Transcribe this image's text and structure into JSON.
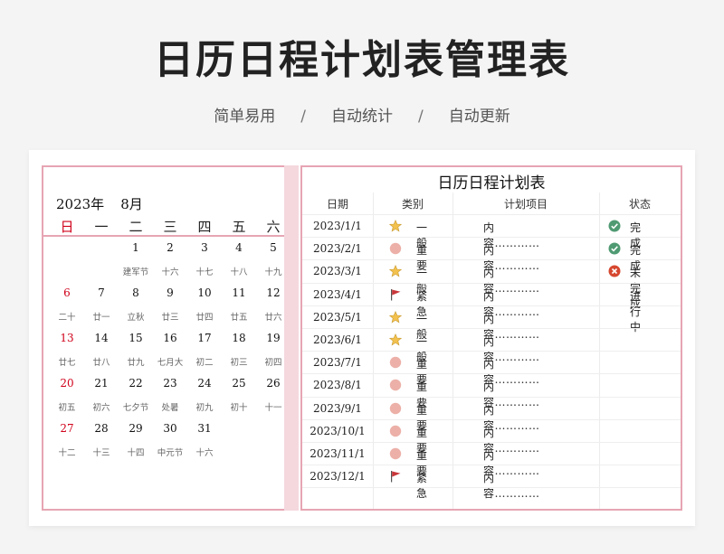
{
  "header": {
    "title": "日历日程计划表管理表",
    "subtitle": [
      "简单易用",
      "自动统计",
      "自动更新"
    ],
    "separator": "/"
  },
  "calendar": {
    "year_label": "2023年",
    "month_label": "8月",
    "weekdays": [
      "日",
      "一",
      "二",
      "三",
      "四",
      "五",
      "六"
    ],
    "weeks": [
      [
        [
          "",
          ""
        ],
        [
          "",
          ""
        ],
        [
          "1",
          "建军节"
        ],
        [
          "2",
          "十六"
        ],
        [
          "3",
          "十七"
        ],
        [
          "4",
          "十八"
        ],
        [
          "5",
          "十九"
        ]
      ],
      [
        [
          "6",
          "二十"
        ],
        [
          "7",
          "廿一"
        ],
        [
          "8",
          "立秋"
        ],
        [
          "9",
          "廿三"
        ],
        [
          "10",
          "廿四"
        ],
        [
          "11",
          "廿五"
        ],
        [
          "12",
          "廿六"
        ]
      ],
      [
        [
          "13",
          "廿七"
        ],
        [
          "14",
          "廿八"
        ],
        [
          "15",
          "廿九"
        ],
        [
          "16",
          "七月大"
        ],
        [
          "17",
          "初二"
        ],
        [
          "18",
          "初三"
        ],
        [
          "19",
          "初四"
        ]
      ],
      [
        [
          "20",
          "初五"
        ],
        [
          "21",
          "初六"
        ],
        [
          "22",
          "七夕节"
        ],
        [
          "23",
          "处暑"
        ],
        [
          "24",
          "初九"
        ],
        [
          "25",
          "初十"
        ],
        [
          "26",
          "十一"
        ]
      ],
      [
        [
          "27",
          "十二"
        ],
        [
          "28",
          "十三"
        ],
        [
          "29",
          "十四"
        ],
        [
          "30",
          "中元节"
        ],
        [
          "31",
          "十六"
        ],
        [
          "",
          ""
        ],
        [
          "",
          ""
        ]
      ]
    ],
    "colors": {
      "sunday": "#d0021b",
      "border": "#e6a5b3"
    }
  },
  "schedule": {
    "title": "日历日程计划表",
    "columns": [
      "日期",
      "类别",
      "计划项目",
      "状态"
    ],
    "rows": [
      {
        "date": "2023/1/1",
        "icon": "star-icon",
        "category": "一般",
        "item": "内容…………",
        "status_icon": "check-icon",
        "status": "完成"
      },
      {
        "date": "2023/2/1",
        "icon": "circle-icon",
        "category": "重要",
        "item": "内容…………",
        "status_icon": "check-icon",
        "status": "完成"
      },
      {
        "date": "2023/3/1",
        "icon": "star-icon",
        "category": "一般",
        "item": "内容…………",
        "status_icon": "cross-icon",
        "status": "未完成"
      },
      {
        "date": "2023/4/1",
        "icon": "flag-icon",
        "category": "紧急",
        "item": "内容…………",
        "status_icon": "",
        "status": "进行中"
      },
      {
        "date": "2023/5/1",
        "icon": "star-icon",
        "category": "一般",
        "item": "内容…………",
        "status_icon": "",
        "status": ""
      },
      {
        "date": "2023/6/1",
        "icon": "star-icon",
        "category": "一般",
        "item": "内容…………",
        "status_icon": "",
        "status": ""
      },
      {
        "date": "2023/7/1",
        "icon": "circle-icon",
        "category": "重要",
        "item": "内容…………",
        "status_icon": "",
        "status": ""
      },
      {
        "date": "2023/8/1",
        "icon": "circle-icon",
        "category": "重要",
        "item": "内容…………",
        "status_icon": "",
        "status": ""
      },
      {
        "date": "2023/9/1",
        "icon": "circle-icon",
        "category": "重要",
        "item": "内容…………",
        "status_icon": "",
        "status": ""
      },
      {
        "date": "2023/10/1",
        "icon": "circle-icon",
        "category": "重要",
        "item": "内容…………",
        "status_icon": "",
        "status": ""
      },
      {
        "date": "2023/11/1",
        "icon": "circle-icon",
        "category": "重要",
        "item": "内容…………",
        "status_icon": "",
        "status": ""
      },
      {
        "date": "2023/12/1",
        "icon": "flag-icon",
        "category": "紧急",
        "item": "内容…………",
        "status_icon": "",
        "status": ""
      }
    ],
    "colors": {
      "star": "#f2c14e",
      "circle": "#ecb0a8",
      "flag": "#c8373a",
      "check": "#4f9a72",
      "cross": "#d6472f"
    }
  }
}
